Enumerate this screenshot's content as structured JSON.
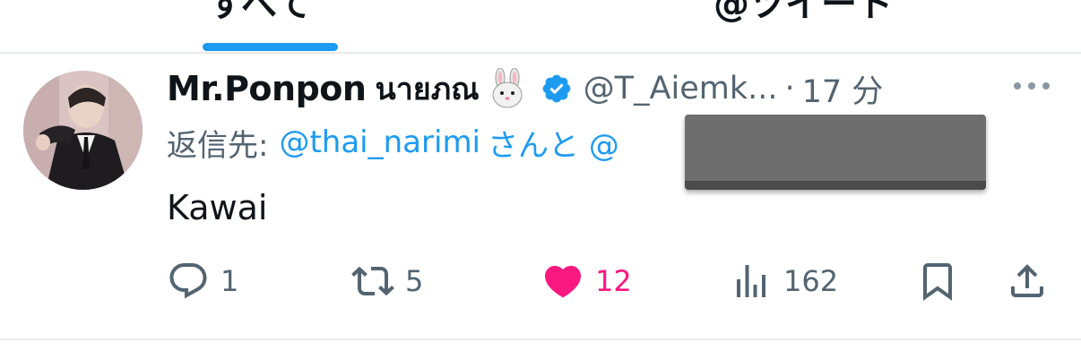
{
  "tabs": [
    {
      "label": "すべて",
      "active": true
    },
    {
      "label": "@ツイート",
      "active": false
    }
  ],
  "tweet": {
    "display_name": "Mr.Ponpon",
    "thai_name": "นายภณ",
    "rabbit_icon": "rabbit-face-emoji",
    "verified_icon": "verified-badge-icon",
    "handle": "@T_Aiemk...",
    "separator": "·",
    "time": "17 分",
    "reply_prefix": "返信先:",
    "reply_user": "@thai_narimi",
    "reply_and": "さんと @",
    "text": "Kawai",
    "stats": {
      "replies": "1",
      "retweets": "5",
      "likes": "12",
      "views": "162"
    }
  },
  "colors": {
    "accent": "#1d9bf0",
    "like": "#f91880",
    "muted": "#536471",
    "text": "#0f1419",
    "divider": "#e7e9ea"
  }
}
